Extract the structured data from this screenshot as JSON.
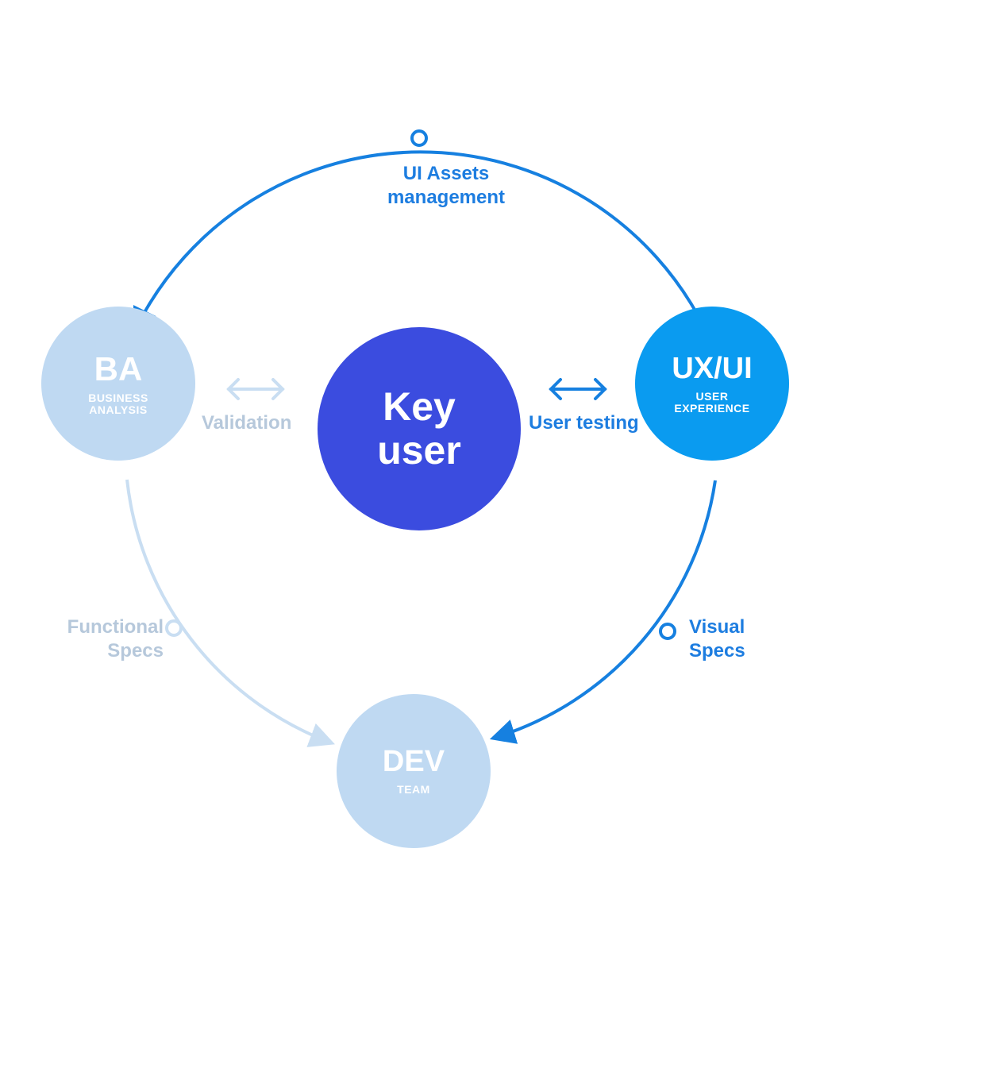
{
  "colors": {
    "center": "#3b4cdf",
    "uxui": "#0a9bf0",
    "faded_fill": "#bfd9f2",
    "strong_line": "#1680e0",
    "faded_line": "#c9def2",
    "strong_text": "#1d7de0",
    "faded_text": "#b6c8db"
  },
  "nodes": {
    "center": {
      "title": "Key\nuser"
    },
    "ba": {
      "title": "BA",
      "sub": "BUSINESS\nANALYSIS"
    },
    "uxui": {
      "title": "UX/UI",
      "sub": "USER\nEXPERIENCE"
    },
    "dev": {
      "title": "DEV",
      "sub": "TEAM"
    }
  },
  "edges": {
    "top": {
      "label": "UI Assets\nmanagement"
    },
    "right_mid": {
      "label": "User testing"
    },
    "left_mid": {
      "label": "Validation"
    },
    "right_down": {
      "label": "Visual\nSpecs"
    },
    "left_down": {
      "label": "Functional\nSpecs"
    }
  }
}
